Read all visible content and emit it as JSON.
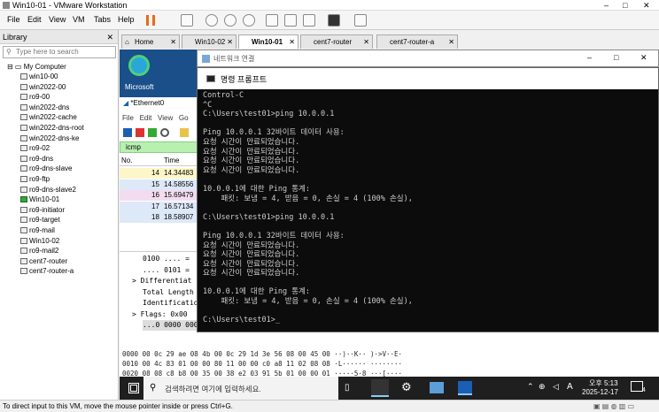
{
  "window": {
    "title": "Win10-01 - VMware Workstation",
    "min": "–",
    "max": "□",
    "close": "✕"
  },
  "menu": [
    "File",
    "Edit",
    "View",
    "VM",
    "Tabs",
    "Help"
  ],
  "library": {
    "title": "Library",
    "search_placeholder": "Type here to search",
    "root": "My Computer",
    "items": [
      "win10-00",
      "win2022-00",
      "ro9-00",
      "win2022-dns",
      "win2022-cache",
      "win2022-dns-root",
      "win2022-dns-ke",
      "ro9-02",
      "ro9-dns",
      "ro9-dns-slave",
      "ro9-ftp",
      "ro9-dns-slave2",
      "Win10-01",
      "ro9-initiator",
      "ro9-target",
      "ro9-mail",
      "Win10-02",
      "ro9-mail2",
      "cent7-router",
      "cent7-router-a"
    ]
  },
  "tabs": [
    "Home",
    "Win10-02",
    "Win10-01",
    "cent7-router",
    "cent7-router-a"
  ],
  "guest": {
    "desktop_label": "Microsoft",
    "wireshark_title": "*Ethernet0",
    "wireshark_menu": [
      "File",
      "Edit",
      "View",
      "Go"
    ],
    "filter": "icmp",
    "col_no": "No.",
    "col_time": "Time",
    "packets": [
      {
        "no": "14",
        "time": "14.34483"
      },
      {
        "no": "15",
        "time": "14.58556"
      },
      {
        "no": "16",
        "time": "15.69479"
      },
      {
        "no": "17",
        "time": "16.57134"
      },
      {
        "no": "18",
        "time": "18.58907"
      }
    ],
    "details": [
      "0100 .... =",
      ".... 0101 =",
      "> Differentiat",
      "Total Length",
      "Identificatio",
      "> Flags: 0x00",
      "...0 0000 000"
    ],
    "hex_lines": [
      "0000   00 0c 29 ae 08 4b 00 0c  29 1d 3e 56 08 00 45 00   ··)··K·· )·>V··E·",
      "0010   00 4c 83 01 00 00 80 11  00 00 c0 a8 11 02 08 08   ·L······ ········",
      "0020   08 08 c8 b8 00 35 00 38  e2 03 91 5b 01 00 00 01   ·····5·8 ···[····"
    ],
    "net_window_title": "네트워크 연결",
    "cmd_title": "명령 프롬프트",
    "cmd_lines": [
      "Control-C",
      "^C",
      "C:\\Users\\test01>ping 10.0.0.1",
      "",
      "Ping 10.0.0.1 32바이트 데이터 사용:",
      "요청 시간이 만료되었습니다.",
      "요청 시간이 만료되었습니다.",
      "요청 시간이 만료되었습니다.",
      "요청 시간이 만료되었습니다.",
      "",
      "10.0.0.1에 대한 Ping 통계:",
      "    패킷: 보냄 = 4, 받음 = 0, 손실 = 4 (100% 손실),",
      "",
      "C:\\Users\\test01>ping 10.0.0.1",
      "",
      "Ping 10.0.0.1 32바이트 데이터 사용:",
      "요청 시간이 만료되었습니다.",
      "요청 시간이 만료되었습니다.",
      "요청 시간이 만료되었습니다.",
      "요청 시간이 만료되었습니다.",
      "",
      "10.0.0.1에 대한 Ping 통계:",
      "    패킷: 보냄 = 4, 받음 = 0, 손실 = 4 (100% 손실),",
      "",
      "C:\\Users\\test01>_"
    ],
    "taskbar": {
      "search_placeholder": "검색하려면 여기에 입력하세요.",
      "ime": "A",
      "time": "오후 5:13",
      "date": "2025-12-17",
      "notif_count": "4"
    }
  },
  "status": "To direct input to this VM, move the mouse pointer inside or press Ctrl+G."
}
